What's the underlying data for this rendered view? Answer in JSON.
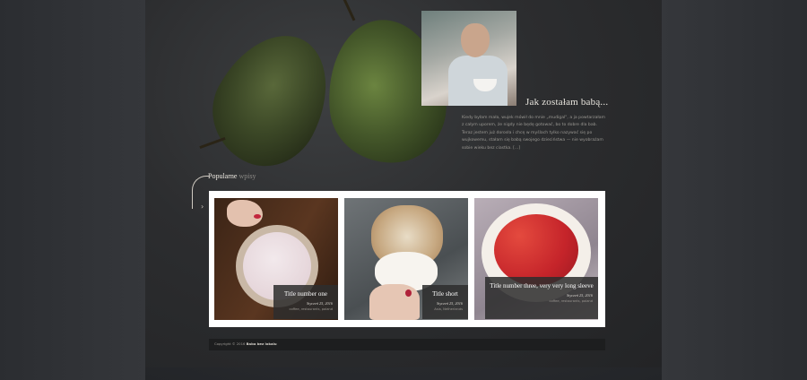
{
  "feature": {
    "title": "Jak zostałam babą...",
    "excerpt": "Kiedy byłam mała, wujek mówił do mnie „mudigal\", a ja powtarzałam z całym uporem, że nigdy nie będę gotować, bo to dobre dla bab. Teraz jestem już dorosła i chcę w myślach tylko nazywać się po wujkowemu, stałam się babą swojego dzieciństwa — nie wyobrażam sobie wieku bez ciastka. [...]"
  },
  "popular": {
    "label": "Popularne",
    "label_muted": "wpisy"
  },
  "cards": [
    {
      "title": "Title number one",
      "date": "Styczeń 25, 2016",
      "tags": "coffee, restaurants, poland"
    },
    {
      "title": "Title short",
      "date": "Styczeń 25, 2016",
      "tags": "Asia, Netherlands"
    },
    {
      "title": "Title number three, very very long sleeve",
      "date": "Styczeń 25, 2016",
      "tags": "coffee, restaurants, poland"
    }
  ],
  "footer": {
    "copyright": "Copyright © 2016",
    "brand": "Baba bez lokalu"
  }
}
